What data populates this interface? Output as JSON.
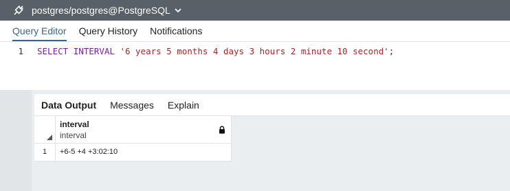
{
  "topbar": {
    "connection_label": "postgres/postgres@PostgreSQL",
    "connection_icon": "plug-icon"
  },
  "tabs": [
    {
      "label": "Query Editor",
      "active": true
    },
    {
      "label": "Query History",
      "active": false
    },
    {
      "label": "Notifications",
      "active": false
    }
  ],
  "editor": {
    "line_number": "1",
    "tokens": {
      "kw_select": "SELECT",
      "kw_interval": "INTERVAL",
      "literal": "'6 years 5 months 4 days 3 hours 2 minute 10 second'",
      "terminator": ";"
    }
  },
  "results": {
    "tabs": [
      {
        "label": "Data Output",
        "active": true
      },
      {
        "label": "Messages",
        "active": false
      },
      {
        "label": "Explain",
        "active": false
      }
    ],
    "columns": [
      {
        "name": "interval",
        "type": "interval"
      }
    ],
    "rows": [
      {
        "row_number": "1",
        "values": [
          "+6-5 +4 +3:02:10"
        ]
      }
    ]
  },
  "colors": {
    "topbar_bg": "#5a6068",
    "accent": "#326690",
    "keyword": "#7a1fa2",
    "string": "#a5262c"
  }
}
